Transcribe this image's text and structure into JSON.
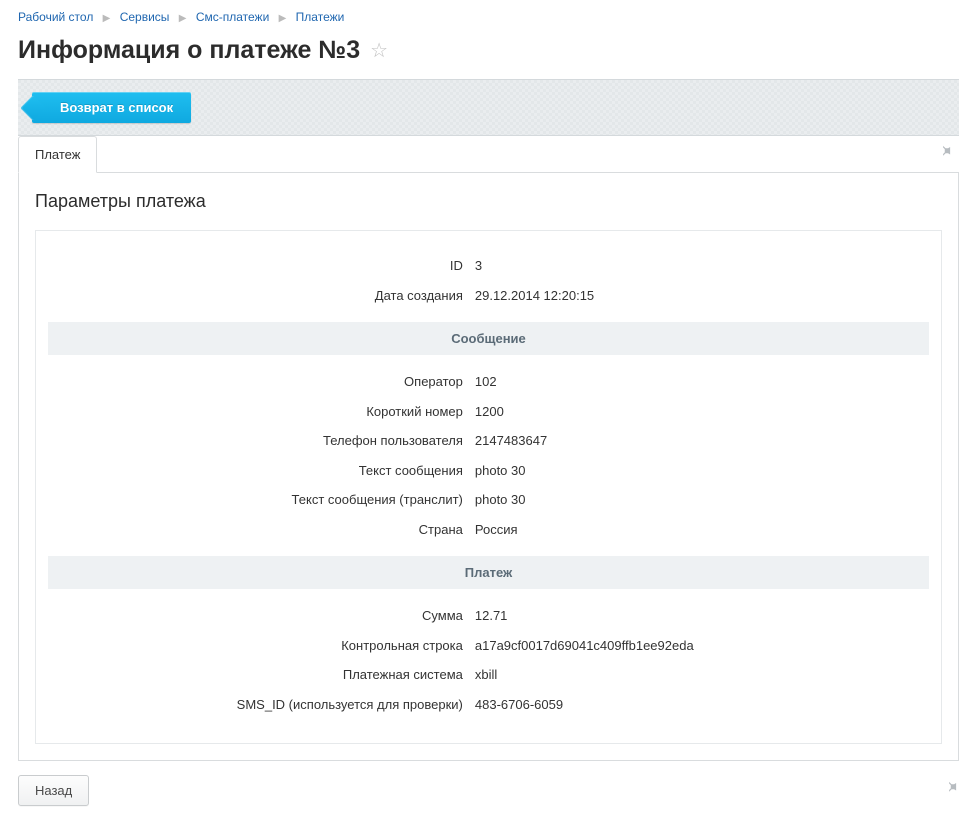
{
  "breadcrumb": [
    {
      "label": "Рабочий стол"
    },
    {
      "label": "Сервисы"
    },
    {
      "label": "Смс-платежи"
    },
    {
      "label": "Платежи"
    }
  ],
  "page_title": "Информация о платеже №3",
  "toolbar": {
    "return_label": "Возврат в список"
  },
  "tabs": {
    "payment": "Платеж"
  },
  "panel": {
    "heading": "Параметры платежа",
    "sections": {
      "message_title": "Сообщение",
      "payment_title": "Платеж"
    },
    "labels": {
      "id": "ID",
      "created": "Дата создания",
      "operator": "Оператор",
      "short_number": "Короткий номер",
      "user_phone": "Телефон пользователя",
      "msg_text": "Текст сообщения",
      "msg_translit": "Текст сообщения (транслит)",
      "country": "Страна",
      "amount": "Сумма",
      "control_string": "Контрольная строка",
      "pay_system": "Платежная система",
      "sms_id": "SMS_ID (используется для проверки)"
    },
    "values": {
      "id": "3",
      "created": "29.12.2014 12:20:15",
      "operator": "102",
      "short_number": "1200",
      "user_phone": "2147483647",
      "msg_text": "photo 30",
      "msg_translit": "photo 30",
      "country": "Россия",
      "amount": "12.71",
      "control_string": "a17a9cf0017d69041c409ffb1ee92eda",
      "pay_system": "xbill",
      "sms_id": "483-6706-6059"
    }
  },
  "footer": {
    "back_label": "Назад"
  }
}
